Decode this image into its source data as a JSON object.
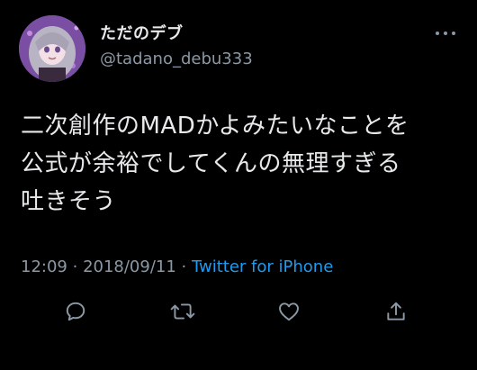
{
  "author": {
    "display_name": "ただのデブ",
    "handle": "@tadano_debu333",
    "avatar_icon": "avatar-image"
  },
  "tweet": {
    "lines": [
      "二次創作のMADかよみたいなことを",
      "公式が余裕でしてくんの無理すぎる",
      "吐きそう"
    ]
  },
  "meta": {
    "time": "12:09",
    "separator": "·",
    "date": "2018/09/11",
    "source": "Twitter for iPhone"
  },
  "actions": [
    {
      "name": "reply-icon"
    },
    {
      "name": "retweet-icon"
    },
    {
      "name": "like-icon"
    },
    {
      "name": "share-icon"
    }
  ],
  "colors": {
    "background": "#000000",
    "text": "#e7e9ea",
    "secondary": "#8b98a5",
    "link": "#1d9bf0"
  }
}
